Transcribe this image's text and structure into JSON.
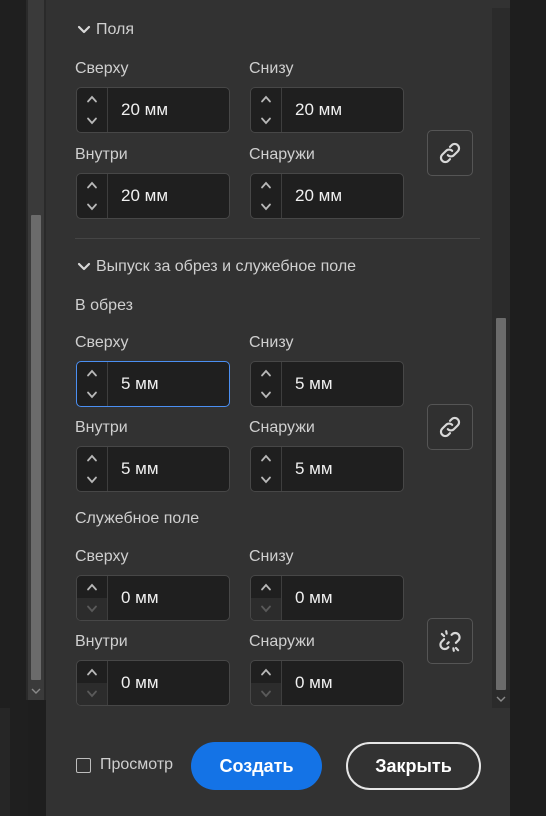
{
  "margins": {
    "heading": "Поля",
    "top": {
      "label": "Сверху",
      "value": "20 мм"
    },
    "bottom": {
      "label": "Снизу",
      "value": "20 мм"
    },
    "inside": {
      "label": "Внутри",
      "value": "20 мм"
    },
    "outside": {
      "label": "Снаружи",
      "value": "20 мм"
    },
    "link_icon": "link-icon"
  },
  "bleed_slug": {
    "heading": "Выпуск за обрез и служебное поле",
    "bleed": {
      "heading": "В обрез",
      "top": {
        "label": "Сверху",
        "value": "5 мм"
      },
      "bottom": {
        "label": "Снизу",
        "value": "5 мм"
      },
      "inside": {
        "label": "Внутри",
        "value": "5 мм"
      },
      "outside": {
        "label": "Снаружи",
        "value": "5 мм"
      },
      "link_icon": "link-icon"
    },
    "slug": {
      "heading": "Служебное поле",
      "top": {
        "label": "Сверху",
        "value": "0 мм"
      },
      "bottom": {
        "label": "Снизу",
        "value": "0 мм"
      },
      "inside": {
        "label": "Внутри",
        "value": "0 мм"
      },
      "outside": {
        "label": "Снаружи",
        "value": "0 мм"
      },
      "link_icon": "unlink-icon"
    }
  },
  "footer": {
    "preview_label": "Просмотр",
    "create_label": "Создать",
    "close_label": "Закрыть"
  },
  "colors": {
    "accent": "#1473e6",
    "focus": "#4b8ff2",
    "panel": "#323232"
  }
}
